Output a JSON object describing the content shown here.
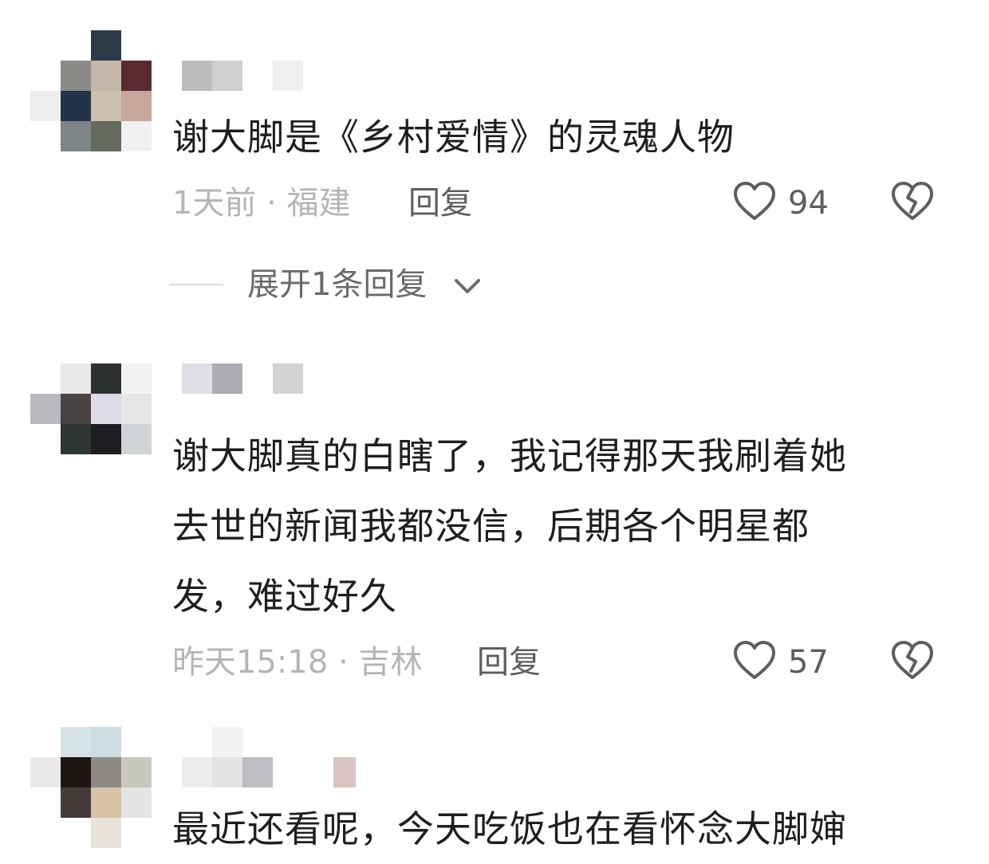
{
  "comments": [
    {
      "content": "谢大脚是《乡村爱情》的灵魂人物",
      "meta": "1天前 · 福建",
      "reply_label": "回复",
      "likes": "94",
      "expand_label": "展开1条回复"
    },
    {
      "content_lines": [
        "谢大脚真的白瞎了，我记得那天我刷着她",
        "去世的新闻我都没信，后期各个明星都",
        "发，难过好久"
      ],
      "meta": "昨天15:18 · 吉林",
      "reply_label": "回复",
      "likes": "57"
    },
    {
      "content": "最近还看呢，今天吃饭也在看怀念大脚婶"
    }
  ],
  "icons": {
    "like": "heart-outline-icon",
    "dislike": "broken-heart-icon",
    "expand": "chevron-down-icon"
  },
  "colors": {
    "text": "#1f1f1f",
    "meta": "#b5b5b5",
    "action": "#5e5e5e"
  }
}
